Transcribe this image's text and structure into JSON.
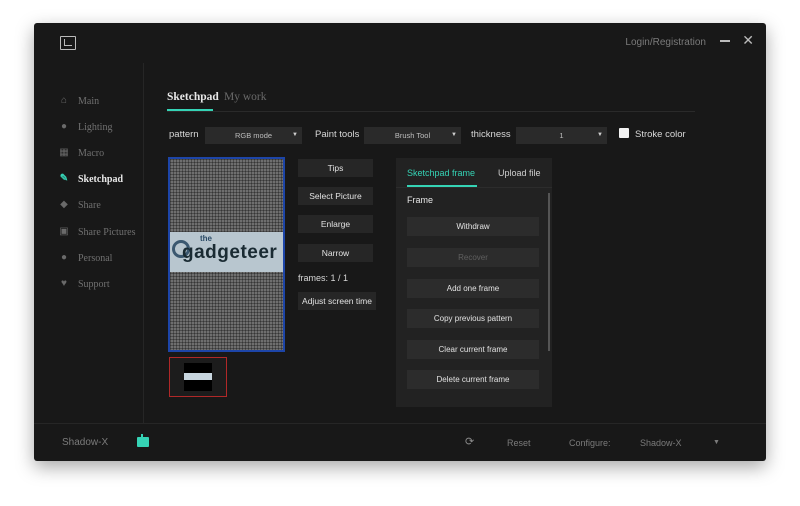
{
  "window": {
    "login_label": "Login/Registration",
    "minimize_glyph": "—",
    "close_glyph": "✕"
  },
  "sidebar": {
    "items": [
      {
        "label": "Main",
        "icon": "home-icon",
        "glyph": "⌂"
      },
      {
        "label": "Lighting",
        "icon": "bulb-icon",
        "glyph": "●"
      },
      {
        "label": "Macro",
        "icon": "macro-icon",
        "glyph": "▦"
      },
      {
        "label": "Sketchpad",
        "icon": "sketchpad-icon",
        "glyph": "✎",
        "active": true
      },
      {
        "label": "Share",
        "icon": "share-icon",
        "glyph": "◆"
      },
      {
        "label": "Share Pictures",
        "icon": "picture-icon",
        "glyph": "▣"
      },
      {
        "label": "Personal",
        "icon": "person-icon",
        "glyph": "●"
      },
      {
        "label": "Support",
        "icon": "heart-icon",
        "glyph": "♥"
      }
    ]
  },
  "tabs": {
    "sketchpad": "Sketchpad",
    "mywork": "My work"
  },
  "toolbar": {
    "pattern_label": "pattern",
    "pattern_value": "RGB mode",
    "paint_label": "Paint tools",
    "paint_value": "Brush Tool",
    "thickness_label": "thickness",
    "thickness_value": "1",
    "stroke_label": "Stroke color",
    "arrow": "▼"
  },
  "canvas_logo": {
    "small": "the",
    "big": "gadgeteer"
  },
  "tools": {
    "tips": "Tips",
    "select_picture": "Select Picture",
    "enlarge": "Enlarge",
    "narrow": "Narrow",
    "frames": "frames: 1 / 1",
    "adjust": "Adjust screen time"
  },
  "panel": {
    "tab_frame": "Sketchpad frame",
    "tab_upload": "Upload file",
    "frame_heading": "Frame",
    "withdraw": "Withdraw",
    "recover": "Recover",
    "add_frame": "Add one frame",
    "copy_previous": "Copy previous pattern",
    "clear_current": "Clear current frame",
    "delete_current": "Delete current frame"
  },
  "footer": {
    "device": "Shadow-X",
    "refresh_glyph": "⟳",
    "reset": "Reset",
    "configure": "Configure:",
    "config_value": "Shadow-X",
    "arrow": "▼"
  },
  "colors": {
    "accent": "#35d3b5",
    "canvas_border": "#1d45a8",
    "thumb_border": "#b02828"
  }
}
